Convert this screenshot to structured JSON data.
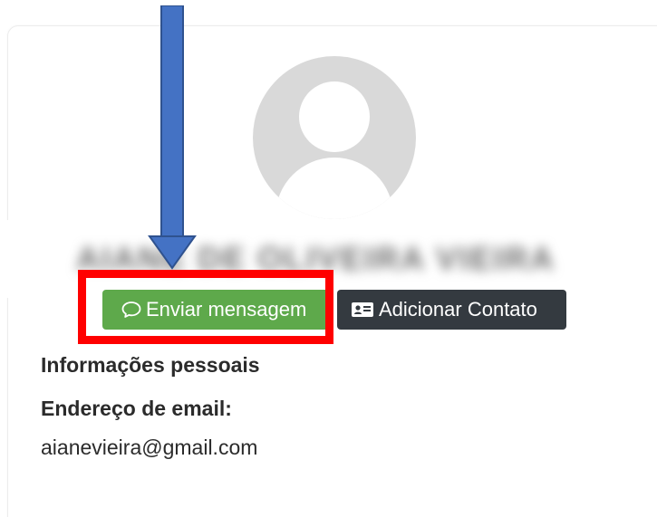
{
  "profile": {
    "name": "AIANE DE OLIVEIRA VIEIRA",
    "avatar_icon": "default-user-avatar"
  },
  "actions": {
    "message_label": "Enviar mensagem",
    "message_icon": "speech-bubble-icon",
    "contact_label": "Adicionar Contato",
    "contact_icon": "contact-card-icon"
  },
  "details": {
    "section_title": "Informações pessoais",
    "email_label": "Endereço de email:",
    "email_value": "aianevieira@gmail.com"
  },
  "colors": {
    "message_button": "#5ea94b",
    "contact_button": "#343a40",
    "highlight": "#ff0000",
    "arrow": "#4472c4"
  }
}
